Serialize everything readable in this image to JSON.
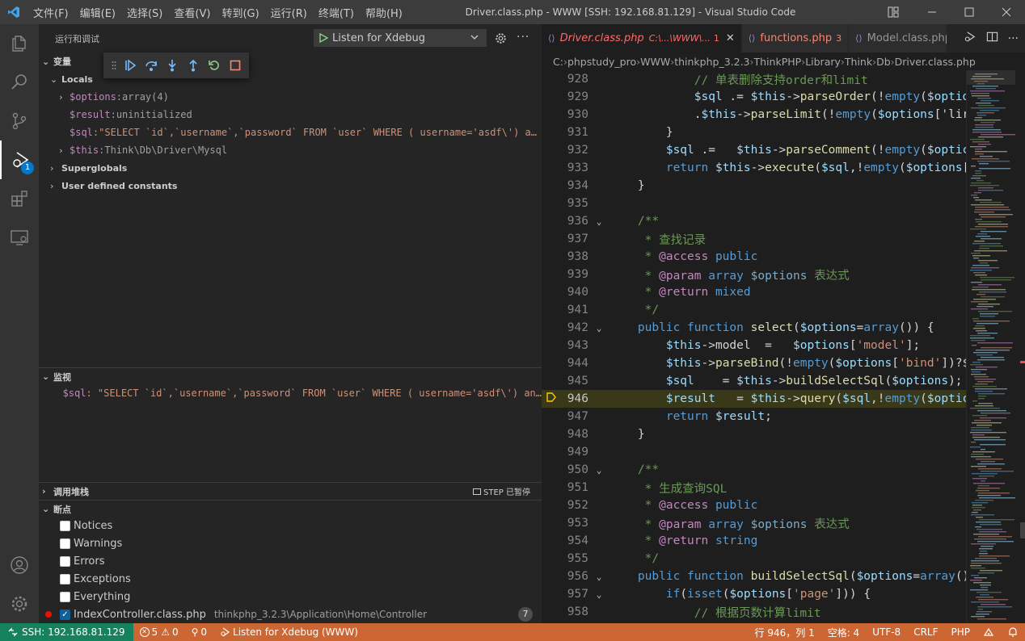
{
  "titlebar": {
    "menu": [
      "文件(F)",
      "编辑(E)",
      "选择(S)",
      "查看(V)",
      "转到(G)",
      "运行(R)",
      "终端(T)",
      "帮助(H)"
    ],
    "window_title": "Driver.class.php - WWW [SSH: 192.168.81.129] - Visual Studio Code"
  },
  "activity": {
    "debug_badge": "1"
  },
  "sidebar": {
    "header_title": "运行和调试",
    "launch_config": "Listen for Xdebug",
    "variables_title": "变量",
    "locals_label": "Locals",
    "locals": [
      {
        "name": "$options",
        "sep": ": ",
        "value": "array(4)",
        "expandable": true
      },
      {
        "name": "$result",
        "sep": ": ",
        "value": "uninitialized",
        "expandable": false
      },
      {
        "name": "$sql",
        "sep": ": ",
        "value": "\"SELECT `id`,`username`,`password` FROM `user` WHERE ( username='asdf\\') a…",
        "expandable": false
      },
      {
        "name": "$this",
        "sep": ": ",
        "value": "Think\\Db\\Driver\\Mysql",
        "expandable": true
      }
    ],
    "superglobals_label": "Superglobals",
    "constants_label": "User defined constants",
    "watch_title": "监视",
    "watch_expr": "$sql",
    "watch_value": ": \"SELECT `id`,`username`,`password` FROM `user` WHERE ( username='asdf\\') an…",
    "callstack_title": "调用堆栈",
    "callstack_status": "STEP 已暂停",
    "breakpoints_title": "断点",
    "breakpoints": [
      {
        "label": "Notices",
        "checked": false
      },
      {
        "label": "Warnings",
        "checked": false
      },
      {
        "label": "Errors",
        "checked": false
      },
      {
        "label": "Exceptions",
        "checked": false
      },
      {
        "label": "Everything",
        "checked": false
      }
    ],
    "file_breakpoint": {
      "file": "IndexController.class.php",
      "path": "thinkphp_3.2.3\\Application\\Home\\Controller",
      "line": "7"
    }
  },
  "editor": {
    "tabs": [
      {
        "name": "Driver.class.php",
        "detail": "C:\\...\\WWW\\...",
        "count": "1",
        "active": true
      },
      {
        "name": "functions.php",
        "detail": "",
        "count": "3",
        "active": false
      },
      {
        "name": "Model.class.php",
        "detail": "",
        "count": "",
        "active": false
      }
    ],
    "breadcrumbs": [
      "C:",
      "phpstudy_pro",
      "WWW",
      "thinkphp_3.2.3",
      "ThinkPHP",
      "Library",
      "Think",
      "Db",
      "Driver.class.php"
    ],
    "current_line": "946",
    "lines": [
      {
        "n": "928",
        "t": "            // 单表删除支持order和limit"
      },
      {
        "n": "929",
        "t": "            $sql .= $this->parseOrder(!empty($optio"
      },
      {
        "n": "930",
        "t": "            .$this->parseLimit(!empty($options['lir"
      },
      {
        "n": "931",
        "t": "        }"
      },
      {
        "n": "932",
        "t": "        $sql .=   $this->parseComment(!empty($optic"
      },
      {
        "n": "933",
        "t": "        return $this->execute($sql,!empty($options["
      },
      {
        "n": "934",
        "t": "    }"
      },
      {
        "n": "935",
        "t": ""
      },
      {
        "n": "936",
        "t": "    /**",
        "fold": true
      },
      {
        "n": "937",
        "t": "     * 查找记录"
      },
      {
        "n": "938",
        "t": "     * @access public"
      },
      {
        "n": "939",
        "t": "     * @param array $options 表达式"
      },
      {
        "n": "940",
        "t": "     * @return mixed"
      },
      {
        "n": "941",
        "t": "     */"
      },
      {
        "n": "942",
        "t": "    public function select($options=array()) {",
        "fold": true
      },
      {
        "n": "943",
        "t": "        $this->model  =   $options['model'];"
      },
      {
        "n": "944",
        "t": "        $this->parseBind(!empty($options['bind'])?$"
      },
      {
        "n": "945",
        "t": "        $sql    = $this->buildSelectSql($options);"
      },
      {
        "n": "946",
        "t": "        $result   = $this->query($sql,!empty($optic"
      },
      {
        "n": "947",
        "t": "        return $result;"
      },
      {
        "n": "948",
        "t": "    }"
      },
      {
        "n": "949",
        "t": ""
      },
      {
        "n": "950",
        "t": "    /**",
        "fold": true
      },
      {
        "n": "951",
        "t": "     * 生成查询SQL"
      },
      {
        "n": "952",
        "t": "     * @access public"
      },
      {
        "n": "953",
        "t": "     * @param array $options 表达式"
      },
      {
        "n": "954",
        "t": "     * @return string"
      },
      {
        "n": "955",
        "t": "     */"
      },
      {
        "n": "956",
        "t": "    public function buildSelectSql($options=array()",
        "fold": true
      },
      {
        "n": "957",
        "t": "        if(isset($options['page'])) {",
        "fold": true
      },
      {
        "n": "958",
        "t": "            // 根据页数计算limit"
      }
    ]
  },
  "statusbar": {
    "remote": "SSH: 192.168.81.129",
    "errors": "5",
    "warnings": "0",
    "ports": "0",
    "debug": "Listen for Xdebug (WWW)",
    "position": "行 946，列 1",
    "spaces": "空格: 4",
    "encoding": "UTF-8",
    "eol": "CRLF",
    "language": "PHP"
  },
  "colors": {
    "statusbar": "#cc6633",
    "error_tab": "#ff6b6b",
    "keyword": "#569cd6",
    "variable": "#9cdcfe",
    "function": "#dcdcaa",
    "comment": "#6a9955"
  }
}
